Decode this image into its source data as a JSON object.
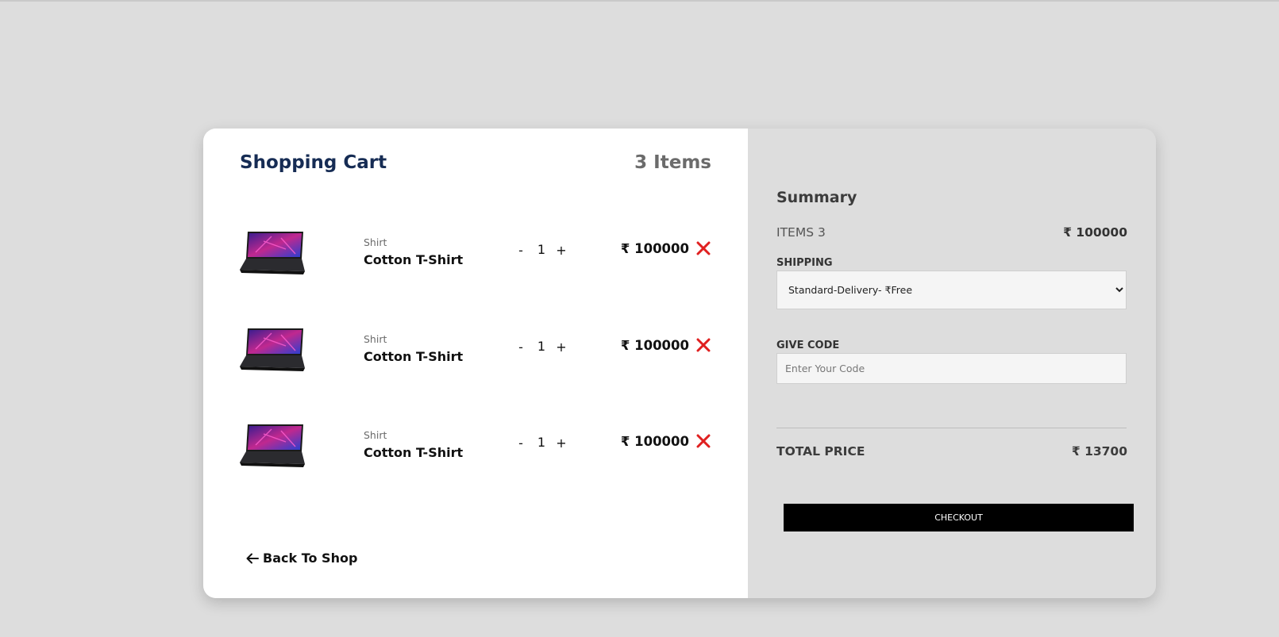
{
  "cart": {
    "title": "Shopping Cart",
    "count_label": "3 Items",
    "items": [
      {
        "category": "Shirt",
        "name": "Cotton T-Shirt",
        "minus": "-",
        "quantity": "1",
        "plus": "+",
        "price": "₹ 100000",
        "image_icon": "laptop-image"
      },
      {
        "category": "Shirt",
        "name": "Cotton T-Shirt",
        "minus": "-",
        "quantity": "1",
        "plus": "+",
        "price": "₹ 100000",
        "image_icon": "laptop-image"
      },
      {
        "category": "Shirt",
        "name": "Cotton T-Shirt",
        "minus": "-",
        "quantity": "1",
        "plus": "+",
        "price": "₹ 100000",
        "image_icon": "laptop-image"
      }
    ],
    "remove_icon": "close-icon",
    "remove_color": "#e02020",
    "back_label": "Back To Shop",
    "back_icon": "arrow-left-icon"
  },
  "summary": {
    "title": "Summary",
    "items_label": "ITEMS 3",
    "items_price": "₹ 100000",
    "shipping_label": "SHIPPING",
    "shipping_selected": "Standard-Delivery- ₹Free",
    "code_label": "GIVE CODE",
    "code_placeholder": "Enter Your Code",
    "total_label": "TOTAL PRICE",
    "total_price": "₹ 13700",
    "checkout_label": "CHECKOUT"
  },
  "colors": {
    "title": "#162c54",
    "background": "#dddddd",
    "checkout_bg": "#000000"
  }
}
